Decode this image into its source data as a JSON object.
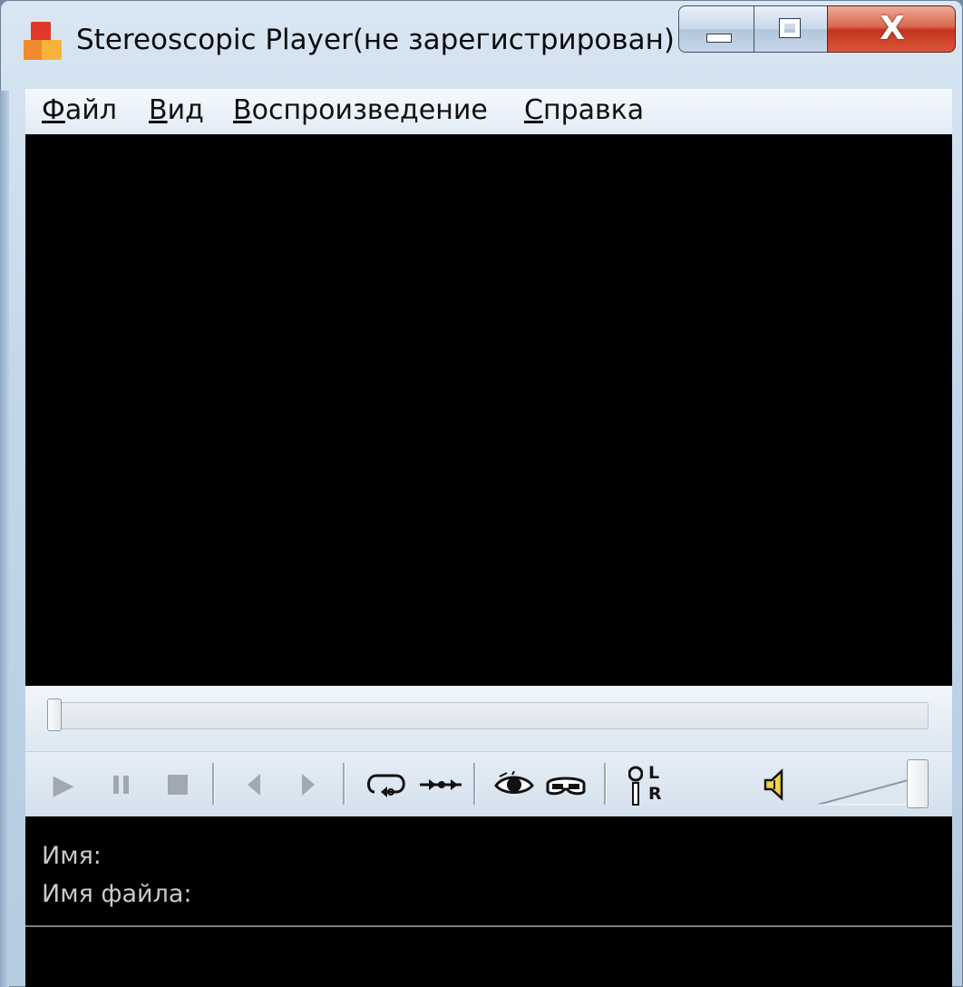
{
  "window": {
    "title": "Stereoscopic Player(не зарегистрирован)",
    "close_glyph": "X"
  },
  "menu": {
    "items": [
      {
        "accel": "Ф",
        "rest": "айл"
      },
      {
        "accel": "В",
        "rest": "ид"
      },
      {
        "accel": "В",
        "rest": "оспроизведение"
      },
      {
        "accel": "С",
        "rest": "правка"
      }
    ]
  },
  "seek": {
    "position": 0.0
  },
  "toolbar": {
    "buttons": [
      {
        "name": "play-icon",
        "glyph": "▶",
        "enabled": false
      },
      {
        "name": "pause-icon",
        "glyph": "❚❚",
        "enabled": false
      },
      {
        "name": "stop-icon",
        "glyph": "■",
        "enabled": false
      },
      {
        "name": "prev-frame-icon",
        "glyph": "◀",
        "enabled": false
      },
      {
        "name": "next-frame-icon",
        "glyph": "▶",
        "enabled": false
      },
      {
        "name": "loop-icon",
        "glyph": "loop",
        "enabled": true
      },
      {
        "name": "sync-icon",
        "glyph": "sync",
        "enabled": true
      },
      {
        "name": "eye-icon",
        "glyph": "eye",
        "enabled": true
      },
      {
        "name": "glasses-icon",
        "glyph": "glasses",
        "enabled": true
      },
      {
        "name": "left-right-swap-icon",
        "glyph": "LR",
        "enabled": true
      },
      {
        "name": "speaker-icon",
        "glyph": "speaker",
        "enabled": true
      }
    ],
    "lr_letters": {
      "l": "L",
      "r": "R"
    },
    "volume": 1.0
  },
  "info": {
    "name_label": "Имя:",
    "filename_label": "Имя файла:"
  },
  "colors": {
    "video_bg": "#000000",
    "info_text": "#c9c9c9",
    "disabled_icon": "#a1a8af"
  }
}
